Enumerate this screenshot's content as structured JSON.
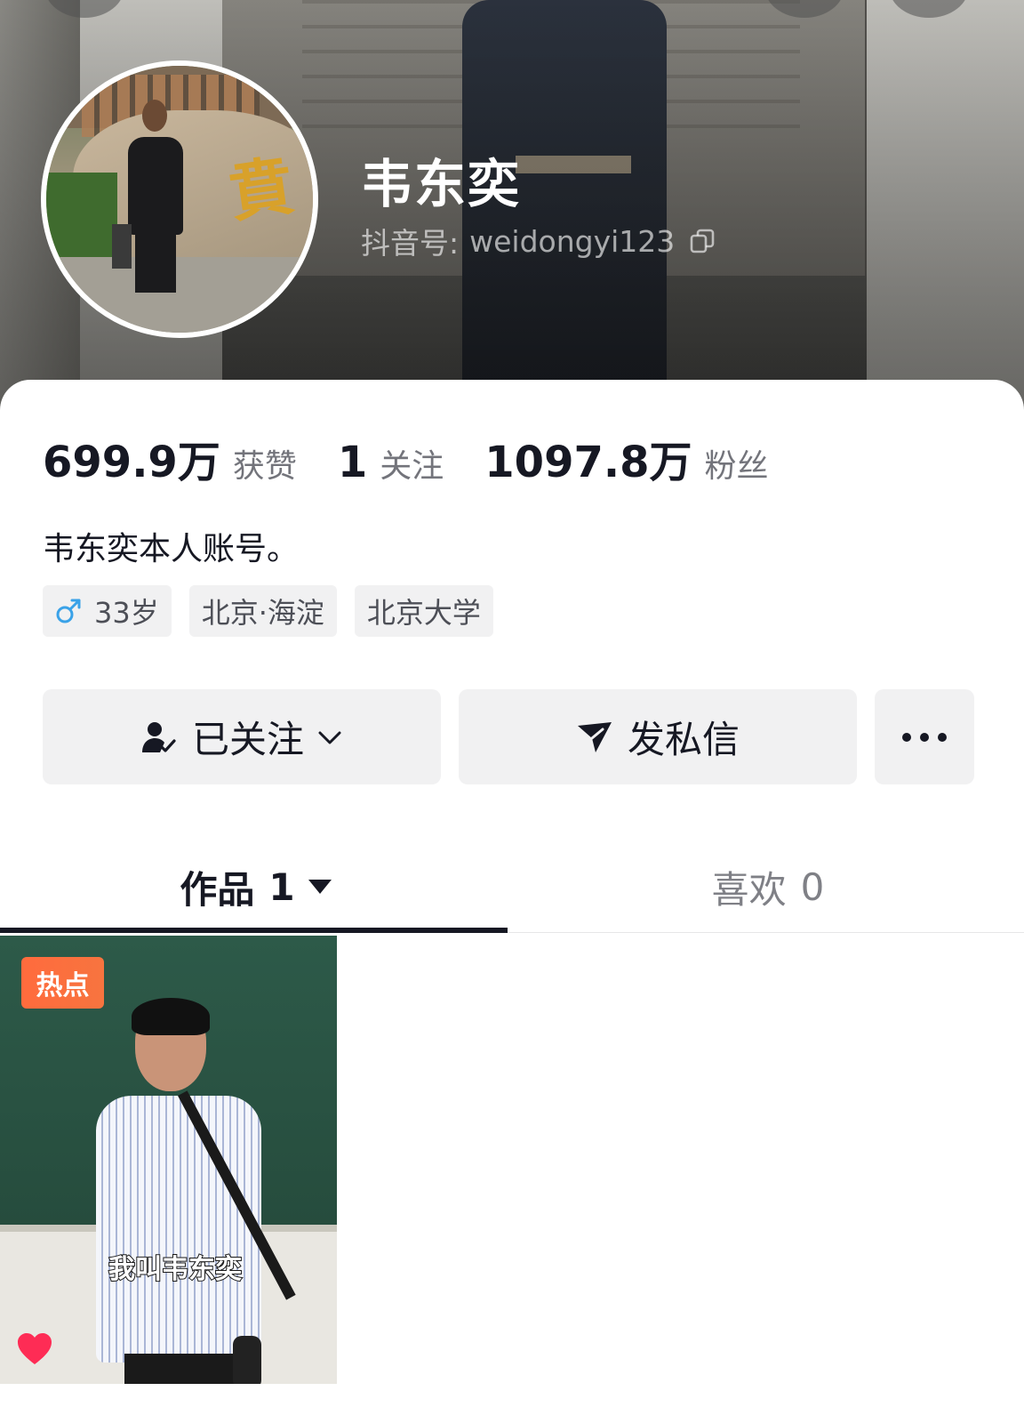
{
  "profile": {
    "display_name": "韦东奕",
    "account_label": "抖音号:",
    "account_id": "weidongyi123",
    "bio": "韦东奕本人账号。"
  },
  "stats": [
    {
      "value": "699.9万",
      "label": "获赞"
    },
    {
      "value": "1",
      "label": "关注"
    },
    {
      "value": "1097.8万",
      "label": "粉丝"
    }
  ],
  "tags": {
    "age": "33岁",
    "location": "北京·海淀",
    "school": "北京大学"
  },
  "actions": {
    "follow_label": "已关注",
    "message_label": "发私信"
  },
  "tabs": {
    "works_label": "作品",
    "works_count": "1",
    "likes_label": "喜欢",
    "likes_count": "0"
  },
  "video": {
    "badge": "热点",
    "caption": "我叫韦东奕"
  },
  "colors": {
    "badge": "#ff6b3d",
    "heart": "#fe2c55",
    "male_icon": "#3aa2e8",
    "text_primary": "#161823",
    "button_bg": "#f1f1f2"
  },
  "icons": [
    "copy-icon",
    "male-icon",
    "followed-user-icon",
    "chevron-down-icon",
    "paper-plane-icon",
    "more-dots-icon",
    "caret-down-icon",
    "heart-icon"
  ]
}
